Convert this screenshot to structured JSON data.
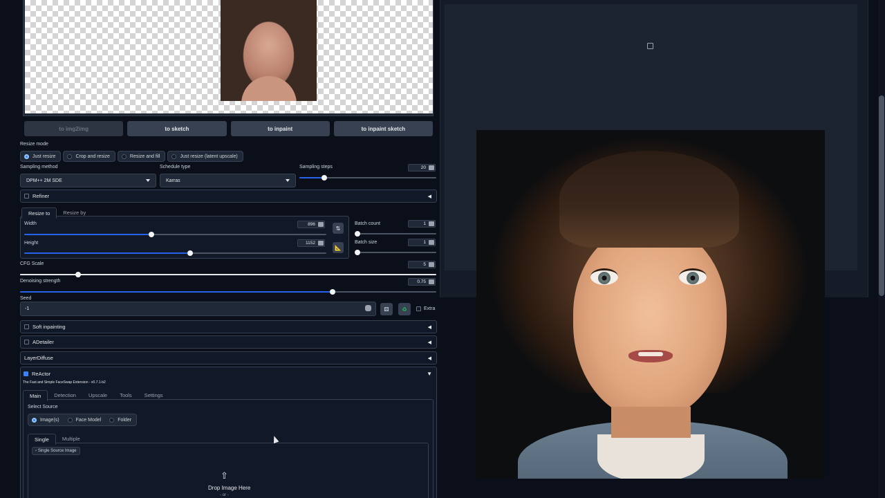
{
  "toolbar": {
    "buttons": [
      "to img2img",
      "to sketch",
      "to inpaint",
      "to inpaint sketch"
    ]
  },
  "resize_mode": {
    "label": "Resize mode",
    "options": [
      "Just resize",
      "Crop and resize",
      "Resize and fill",
      "Just resize (latent upscale)"
    ],
    "selected": "Just resize"
  },
  "sampling": {
    "method_label": "Sampling method",
    "method_value": "DPM++ 2M SDE",
    "schedule_label": "Schedule type",
    "schedule_value": "Karras",
    "steps_label": "Sampling steps",
    "steps_value": "20",
    "steps_level": 0.18
  },
  "refiner": {
    "label": "Refiner"
  },
  "size_tabs": [
    "Resize to",
    "Resize by"
  ],
  "width": {
    "label": "Width",
    "value": "896",
    "level": 0.42
  },
  "height": {
    "label": "Height",
    "value": "1152",
    "level": 0.55
  },
  "batch_count": {
    "label": "Batch count",
    "value": "1"
  },
  "batch_size": {
    "label": "Batch size",
    "value": "1"
  },
  "cfg": {
    "label": "CFG Scale",
    "value": "5",
    "level": 0.14
  },
  "denoise": {
    "label": "Denoising strength",
    "value": "0.75",
    "level": 0.75
  },
  "seed": {
    "label": "Seed",
    "value": "-1",
    "extra_label": "Extra"
  },
  "accordions": {
    "soft_inpainting": "Soft inpainting",
    "adetailer": "ADetailer",
    "layerdiffuse": "LayerDiffuse",
    "reactor": "ReActor"
  },
  "reactor": {
    "subtitle": "The Fast and Simple FaceSwap Extension - v0.7.1-b2",
    "tabs": [
      "Main",
      "Detection",
      "Upscale",
      "Tools",
      "Settings"
    ],
    "select_source_label": "Select Source",
    "source_options": [
      "Image(s)",
      "Face Model",
      "Folder"
    ],
    "source_selected": "Image(s)",
    "mode_tabs": [
      "Single",
      "Multiple"
    ],
    "source_image_label": "Single Source Image",
    "drop_text": "Drop Image Here",
    "or_text": "- or -"
  },
  "colors": {
    "accent": "#3b82f6",
    "background": "#0b0f19",
    "panel": "#111827"
  }
}
